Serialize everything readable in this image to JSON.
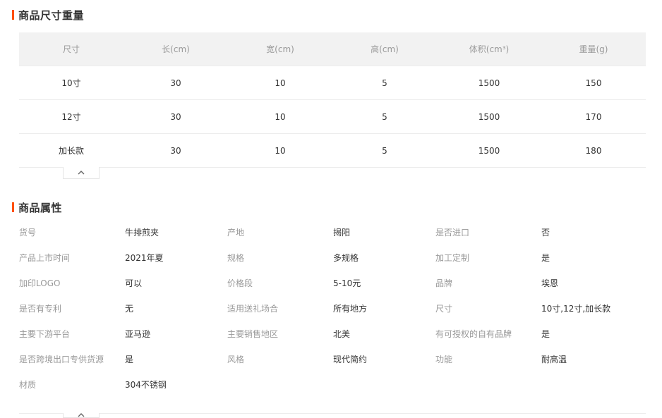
{
  "size_section": {
    "title": "商品尺寸重量",
    "headers": [
      "尺寸",
      "长(cm)",
      "宽(cm)",
      "高(cm)",
      "体积(cm³)",
      "重量(g)"
    ],
    "rows": [
      [
        "10寸",
        "30",
        "10",
        "5",
        "1500",
        "150"
      ],
      [
        "12寸",
        "30",
        "10",
        "5",
        "1500",
        "170"
      ],
      [
        "加长款",
        "30",
        "10",
        "5",
        "1500",
        "180"
      ]
    ]
  },
  "attr_section": {
    "title": "商品属性",
    "rows": [
      [
        [
          "货号",
          "牛排煎夹"
        ],
        [
          "产地",
          "揭阳"
        ],
        [
          "是否进口",
          "否"
        ]
      ],
      [
        [
          "产品上市时间",
          "2021年夏"
        ],
        [
          "规格",
          "多规格"
        ],
        [
          "加工定制",
          "是"
        ]
      ],
      [
        [
          "加印LOGO",
          "可以"
        ],
        [
          "价格段",
          "5-10元"
        ],
        [
          "品牌",
          "埃恩"
        ]
      ],
      [
        [
          "是否有专利",
          "无"
        ],
        [
          "适用送礼场合",
          "所有地方"
        ],
        [
          "尺寸",
          "10寸,12寸,加长款"
        ]
      ],
      [
        [
          "主要下游平台",
          "亚马逊"
        ],
        [
          "主要销售地区",
          "北美"
        ],
        [
          "有可授权的自有品牌",
          "是"
        ]
      ],
      [
        [
          "是否跨境出口专供货源",
          "是"
        ],
        [
          "风格",
          "现代简约"
        ],
        [
          "功能",
          "耐高温"
        ]
      ],
      [
        [
          "材质",
          "304不锈钢"
        ]
      ]
    ]
  },
  "icons": {
    "collapse": "chevron-up-icon"
  },
  "colors": {
    "accent": "#ff5000",
    "header_bg": "#f2f2f2",
    "label_text": "#999999"
  }
}
